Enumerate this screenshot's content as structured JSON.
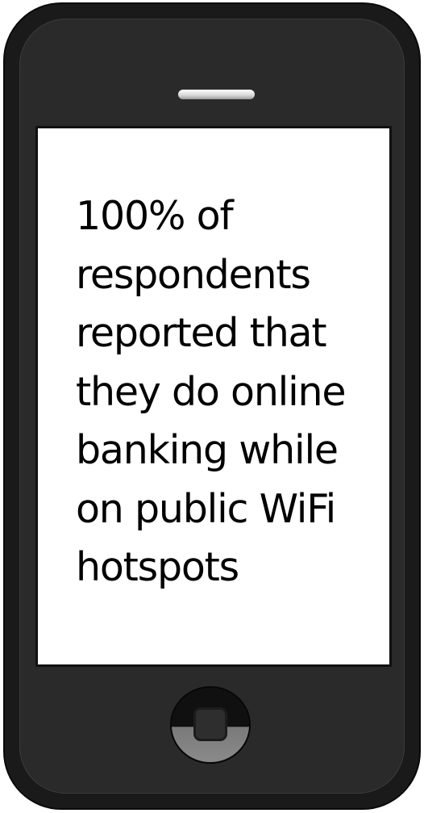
{
  "device": {
    "type": "smartphone",
    "icons": [
      "speaker-grille-icon",
      "home-button-icon"
    ],
    "colors": {
      "body": "#1a1a1a",
      "screen": "#ffffff",
      "text": "#000000"
    }
  },
  "screen": {
    "lines": [
      "100% of",
      "respondents",
      "reported that",
      "they do online",
      "banking while",
      "on public WiFi",
      "hotspots"
    ]
  }
}
